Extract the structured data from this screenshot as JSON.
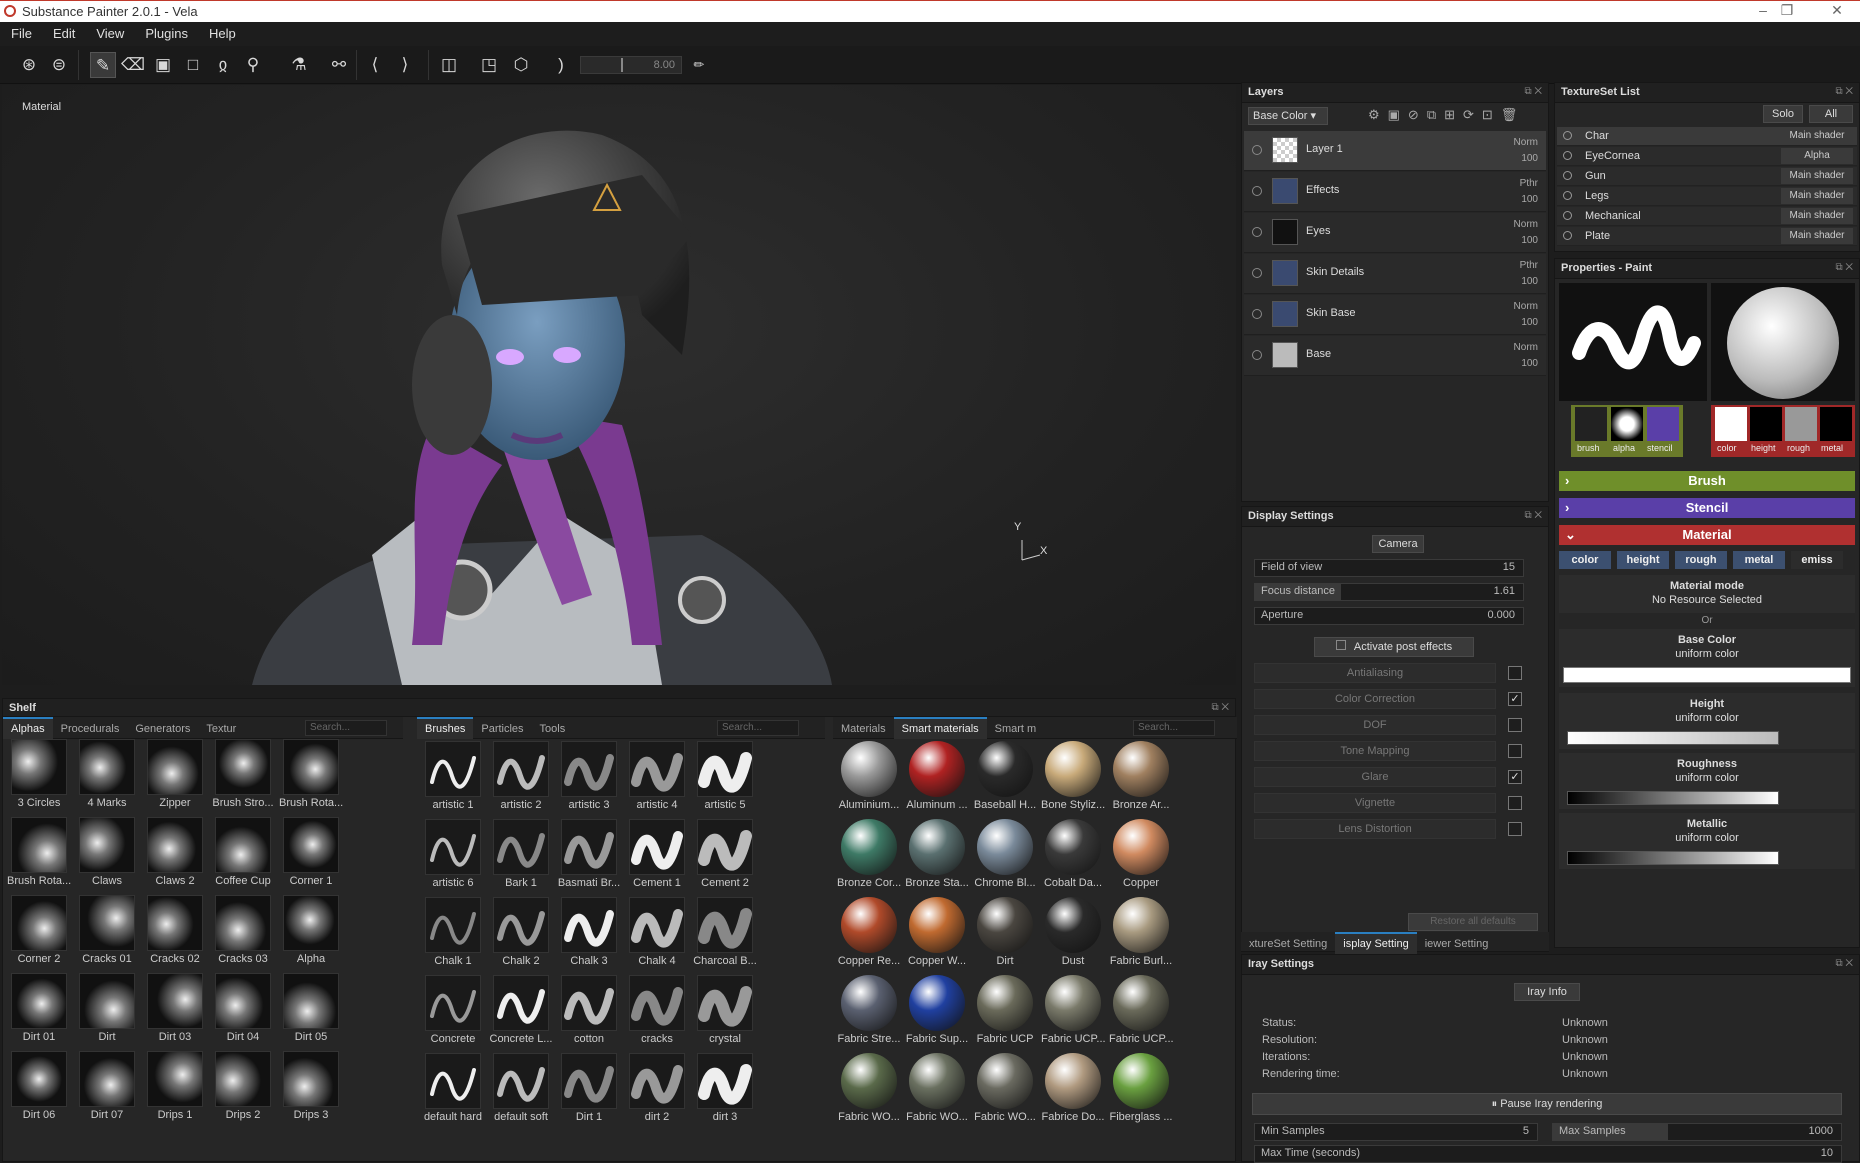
{
  "window": {
    "title": "Substance Painter 2.0.1 - Vela",
    "controls": [
      "–",
      "❐",
      "✕"
    ]
  },
  "menu": [
    "File",
    "Edit",
    "View",
    "Plugins",
    "Help"
  ],
  "toolbar": {
    "slider_value": "8.00"
  },
  "viewport": {
    "label": "Material",
    "axis_y": "Y",
    "axis_x": "X"
  },
  "layers": {
    "title": "Layers",
    "channel": "Base Color ▾",
    "items": [
      {
        "name": "Layer 1",
        "blend": "Norm",
        "opacity": "100"
      },
      {
        "name": "Effects",
        "blend": "Pthr",
        "opacity": "100"
      },
      {
        "name": "Eyes",
        "blend": "Norm",
        "opacity": "100"
      },
      {
        "name": "Skin Details",
        "blend": "Pthr",
        "opacity": "100"
      },
      {
        "name": "Skin Base",
        "blend": "Norm",
        "opacity": "100"
      },
      {
        "name": "Base",
        "blend": "Norm",
        "opacity": "100"
      }
    ]
  },
  "textureset": {
    "title": "TextureSet List",
    "solo": "Solo",
    "all": "All",
    "items": [
      {
        "name": "Char",
        "shader": "Main shader"
      },
      {
        "name": "EyeCornea",
        "shader": "Alpha"
      },
      {
        "name": "Gun",
        "shader": "Main shader"
      },
      {
        "name": "Legs",
        "shader": "Main shader"
      },
      {
        "name": "Mechanical",
        "shader": "Main shader"
      },
      {
        "name": "Plate",
        "shader": "Main shader"
      }
    ]
  },
  "properties": {
    "title": "Properties - Paint",
    "brush_labels": [
      "brush",
      "alpha",
      "stencil"
    ],
    "material_labels": [
      "color",
      "height",
      "rough",
      "metal"
    ],
    "sections": {
      "brush": "Brush",
      "stencil": "Stencil",
      "material": "Material"
    },
    "channels": [
      "color",
      "height",
      "rough",
      "metal",
      "emiss"
    ],
    "material_mode": "Material mode",
    "no_resource": "No Resource Selected",
    "or": "Or",
    "base_color": "Base Color",
    "uniform": "uniform color",
    "height": "Height",
    "roughness": "Roughness",
    "metallic": "Metallic"
  },
  "display": {
    "title": "Display Settings",
    "camera": "Camera",
    "fov_label": "Field of view",
    "fov": "15",
    "focus_label": "Focus distance",
    "focus": "1.61",
    "aperture_label": "Aperture",
    "aperture": "0.000",
    "post_effects": "Activate post effects",
    "effects": [
      {
        "name": "Antialiasing",
        "checked": false
      },
      {
        "name": "Color Correction",
        "checked": true
      },
      {
        "name": "DOF",
        "checked": false
      },
      {
        "name": "Tone Mapping",
        "checked": false
      },
      {
        "name": "Glare",
        "checked": true
      },
      {
        "name": "Vignette",
        "checked": false
      },
      {
        "name": "Lens Distortion",
        "checked": false
      }
    ],
    "restore": "Restore all defaults",
    "bottom_tabs": [
      "xtureSet Setting",
      "isplay Setting",
      "iewer Setting"
    ]
  },
  "iray": {
    "title": "Iray Settings",
    "info_btn": "Iray Info",
    "rows": [
      {
        "label": "Status:",
        "value": "Unknown"
      },
      {
        "label": "Resolution:",
        "value": "Unknown"
      },
      {
        "label": "Iterations:",
        "value": "Unknown"
      },
      {
        "label": "Rendering time:",
        "value": "Unknown"
      }
    ],
    "pause": "⏸ Pause Iray rendering",
    "min_samples_label": "Min Samples",
    "min_samples": "5",
    "max_samples_label": "Max Samples",
    "max_samples": "1000",
    "max_time_label": "Max Time (seconds)",
    "max_time": "10"
  },
  "shelf": {
    "title": "Shelf",
    "tabs1": [
      "Alphas",
      "Procedurals",
      "Generators",
      "Textur"
    ],
    "tabs2": [
      "Brushes",
      "Particles",
      "Tools"
    ],
    "tabs3": [
      "Materials",
      "Smart materials",
      "Smart m"
    ],
    "search": "Search...",
    "alphas": [
      "3 Circles",
      "4 Marks",
      "Zipper",
      "Brush Stro...",
      "Brush Rota...",
      "Brush Rota...",
      "Claws",
      "Claws 2",
      "Coffee Cup",
      "Corner 1",
      "Corner 2",
      "Cracks 01",
      "Cracks 02",
      "Cracks 03",
      "Alpha",
      "Dirt 01",
      "Dirt",
      "Dirt 03",
      "Dirt 04",
      "Dirt 05",
      "Dirt 06",
      "Dirt 07",
      "Drips 1",
      "Drips 2",
      "Drips 3"
    ],
    "brushes": [
      "artistic 1",
      "artistic 2",
      "artistic 3",
      "artistic 4",
      "artistic 5",
      "artistic 6",
      "Bark 1",
      "Basmati Br...",
      "Cement 1",
      "Cement 2",
      "Chalk 1",
      "Chalk 2",
      "Chalk 3",
      "Chalk 4",
      "Charcoal B...",
      "Concrete",
      "Concrete L...",
      "cotton",
      "cracks",
      "crystal",
      "default hard",
      "default soft",
      "Dirt 1",
      "dirt 2",
      "dirt 3"
    ],
    "materials": [
      "Aluminium...",
      "Aluminum ...",
      "Baseball H...",
      "Bone Styliz...",
      "Bronze Ar...",
      "Bronze Cor...",
      "Bronze Sta...",
      "Chrome Bl...",
      "Cobalt Da...",
      "Copper",
      "Copper Re...",
      "Copper W...",
      "Dirt",
      "Dust",
      "Fabric Burl...",
      "Fabric Stre...",
      "Fabric Sup...",
      "Fabric UCP",
      "Fabric UCP...",
      "Fabric UCP...",
      "Fabric WO...",
      "Fabric WO...",
      "Fabric WO...",
      "Fabrice Do...",
      "Fiberglass ..."
    ],
    "material_colors": [
      "#9a9a9a",
      "#b02222",
      "#2a2a2a",
      "#c8aa7a",
      "#a08060",
      "#3e7a66",
      "#5a7070",
      "#7a8a9a",
      "#3a3a3a",
      "#d08a60",
      "#b04a2a",
      "#c06a30",
      "#4a4640",
      "#2a2a2a",
      "#a89a80",
      "#5a6070",
      "#2040a0",
      "#6a6a5a",
      "#7a7a6a",
      "#6a6a5a",
      "#5a6a4a",
      "#6a7060",
      "#6a6a60",
      "#b09a80",
      "#6aa040"
    ]
  },
  "colors": {
    "accent_blue": "#2a7fc1",
    "brush": "#6f8f2a",
    "stencil": "#5a3fa8",
    "material": "#b03030"
  }
}
